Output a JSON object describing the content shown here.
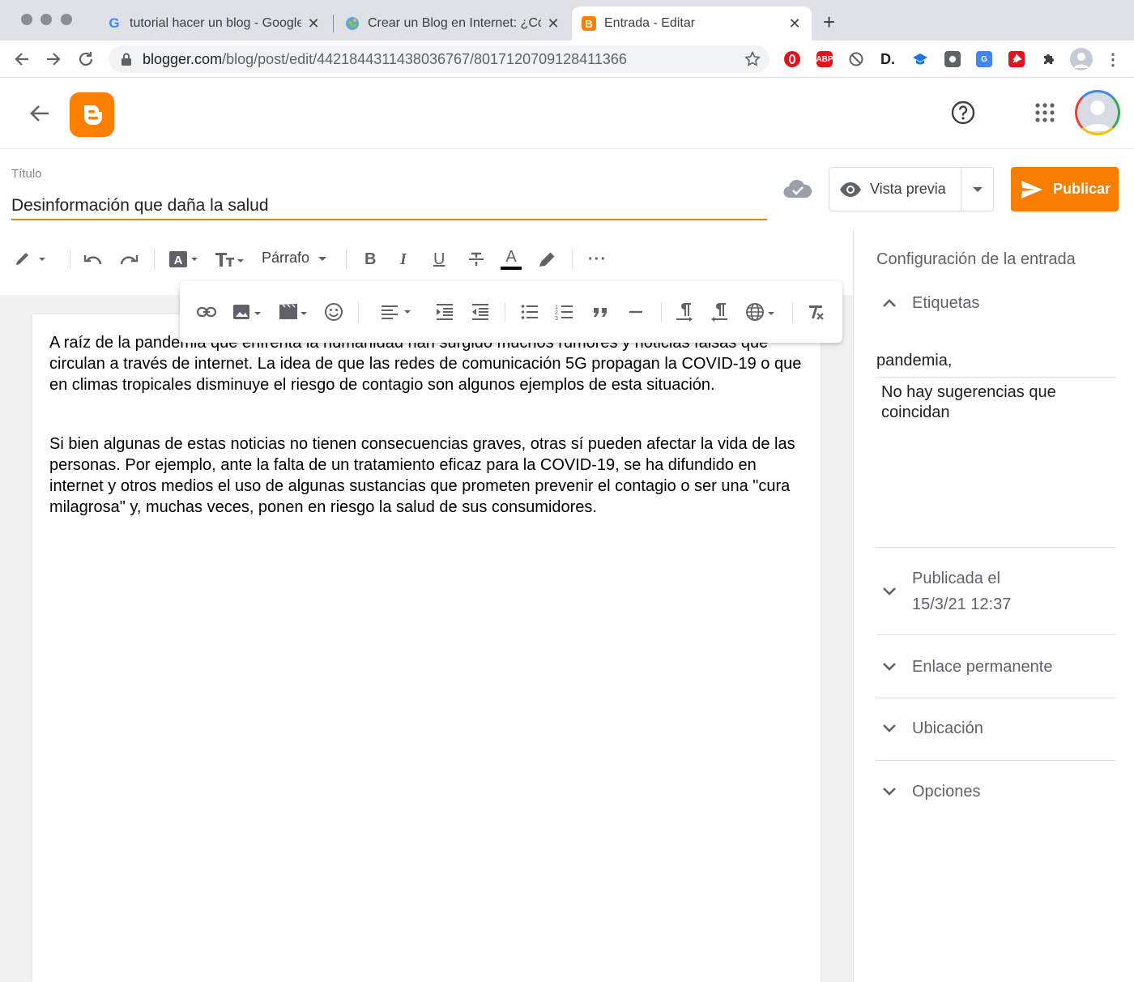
{
  "browser": {
    "tabs": [
      {
        "title": "tutorial hacer un blog - Google",
        "icon": "google-icon"
      },
      {
        "title": "Crear un Blog en Internet: ¿Cómo",
        "icon": "globe-icon"
      },
      {
        "title": "Entrada - Editar",
        "icon": "blogger-icon",
        "active": true
      }
    ],
    "url_host": "blogger.com",
    "url_path": "/blog/post/edit/4421844311438036767/8017120709128411366",
    "extensions": [
      "opera-icon",
      "adblock-icon",
      "blocked-icon",
      "d-icon",
      "cap-icon",
      "square-icon",
      "translate-icon",
      "pin-icon",
      "puzzle-icon",
      "profile-icon"
    ],
    "ext_labels": {
      "adblock": "ABP",
      "d": "D.",
      "translate": "G"
    }
  },
  "header": {
    "logo_letter": "B"
  },
  "post": {
    "title_label": "Título",
    "title": "Desinformación que daña la salud",
    "paragraphs": [
      "A raíz de la pandemia que enfrenta la humanidad han surgido muchos rumores y noticias falsas que circulan a través de internet. La idea de que las redes de comunicación 5G propagan la COVID-19 o que en climas tropicales disminuye el riesgo de contagio son algunos ejemplos de esta situación.",
      "Si bien algunas de estas noticias no tienen consecuencias graves, otras sí pueden afectar la vida de las personas. Por ejemplo, ante la falta de un tratamiento eficaz para la COVID-19, se ha difundido en internet y otros medios el uso de algunas sustancias que prometen prevenir el contagio o ser una \"cura milagrosa\" y, muchas veces, ponen en riesgo la salud de sus consumidores."
    ]
  },
  "actions": {
    "preview_label": "Vista previa",
    "publish_label": "Publicar"
  },
  "toolbar": {
    "paragraph_label": "Párrafo",
    "bold": "B",
    "italic": "I",
    "underline": "U",
    "font_color": "A",
    "more": "···"
  },
  "sidebar": {
    "title": "Configuración de la entrada",
    "labels_header": "Etiquetas",
    "tag_value": "pandemia,",
    "suggestion": "No hay sugerencias que coincidan",
    "published_label": "Publicada el",
    "published_date": "15/3/21 12:37",
    "permalink_label": "Enlace permanente",
    "location_label": "Ubicación",
    "options_label": "Opciones"
  },
  "colors": {
    "brand_orange": "#f57d00",
    "logo_orange": "#ff8000"
  }
}
